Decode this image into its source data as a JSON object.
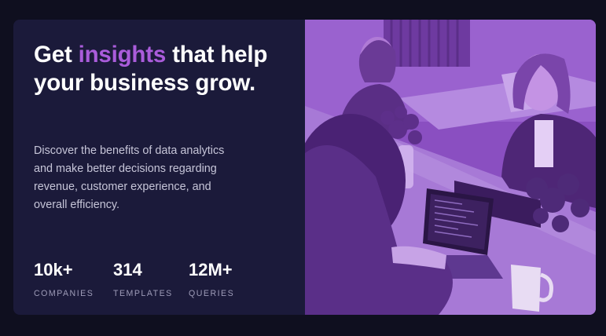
{
  "headline": {
    "before": "Get ",
    "accent": "insights",
    "after": " that help your business grow."
  },
  "description": "Discover the benefits of data analytics and make better decisions regarding revenue, customer experience, and overall efficiency.",
  "stats": [
    {
      "value": "10k+",
      "label": "COMPANIES"
    },
    {
      "value": "314",
      "label": "TEMPLATES"
    },
    {
      "value": "12M+",
      "label": "QUERIES"
    }
  ],
  "colors": {
    "page_background": "#0f0f1f",
    "card_background": "#1b1a3a",
    "accent": "#aa5cdb",
    "photo_overlay": "#8a4fc1"
  },
  "image": {
    "alt": "Team working together at a table with laptops"
  }
}
